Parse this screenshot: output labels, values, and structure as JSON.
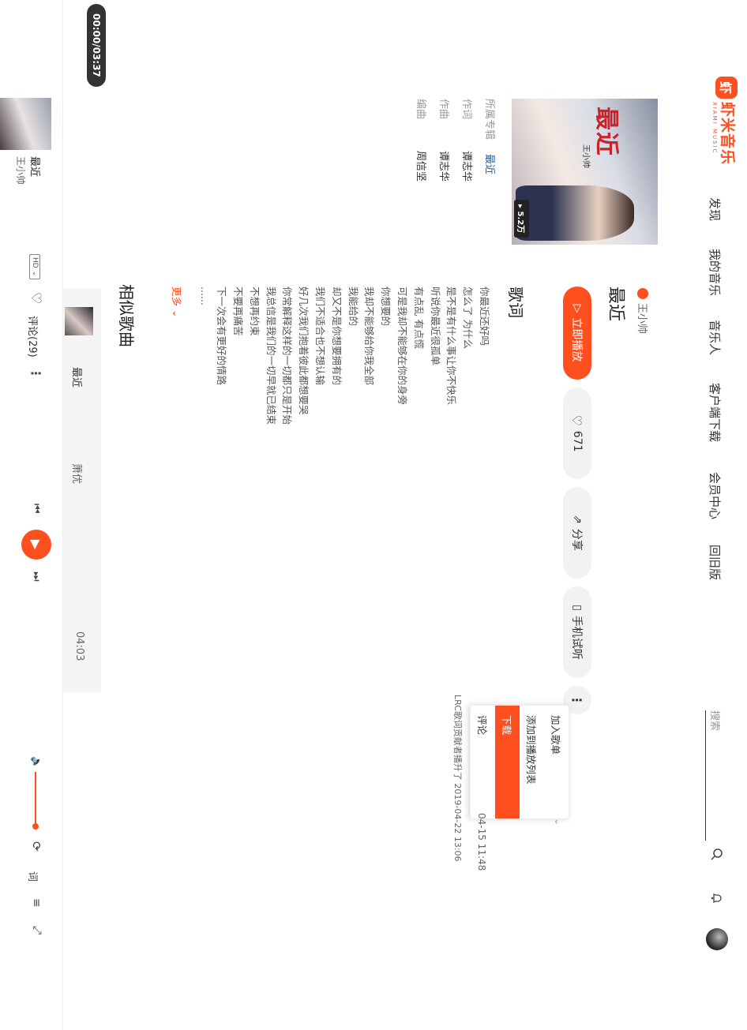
{
  "header": {
    "logo_text": "虾米音乐",
    "logo_sub": "XIAMI MUSIC",
    "nav": [
      "发现",
      "我的音乐",
      "音乐人",
      "客户端下载",
      "会员中心",
      "回旧版"
    ],
    "search_placeholder": "搜索"
  },
  "song": {
    "artist": "王小帅",
    "title": "最近",
    "cover_text": "最近",
    "cover_artist": "王小帅",
    "play_count": "5.2万",
    "album_label": "所属专辑",
    "album_value": "最近",
    "lyricist_label": "作词",
    "lyricist_value": "谭志华",
    "composer_label": "作曲",
    "composer_value": "谭志华",
    "arranger_label": "编曲",
    "arranger_value": "周信坚"
  },
  "actions": {
    "play": "立即播放",
    "like": "671",
    "share": "分享",
    "phone": "手机试听"
  },
  "menu": {
    "items": [
      "加入歌单",
      "添加到播放列表",
      "下载",
      "评论"
    ]
  },
  "meta_right": {
    "line1": "04-15 11:48",
    "line2": "LRC歌词贡献者播升了 2019-04-22 13:06"
  },
  "lyrics": {
    "heading": "歌词",
    "lines": [
      "你最近还好吗",
      "怎么了 为什么",
      "是不是有什么事让你不快乐",
      "听说你最近很孤单",
      "有点乱 有点慌",
      "可是我却不能够在你的身旁",
      "你想要的",
      "我却不能够给你我全部",
      "我能给的",
      "却又不是你想要拥有的",
      "我们不适合也不想认输",
      "好几次我们抱着彼此都想要哭",
      "你常解释这样的一切都只是开始",
      "我总信是我们的一切早就已结束",
      "不想再约束",
      "不要再痛苦",
      "下一次会有更好的情路"
    ],
    "ellipsis": "......",
    "more": "更多"
  },
  "similar": {
    "heading": "相似歌曲",
    "items": [
      {
        "title": "最近",
        "artist": "萧优",
        "duration": "04:03"
      }
    ]
  },
  "player": {
    "time": "00:00/03:37",
    "title": "最近",
    "artist": "王小帅",
    "hd": "HD",
    "comments": "评论(29)",
    "lyric_btn": "词",
    "list_btn": "≡"
  },
  "colors": {
    "accent": "#ff4f1f"
  }
}
